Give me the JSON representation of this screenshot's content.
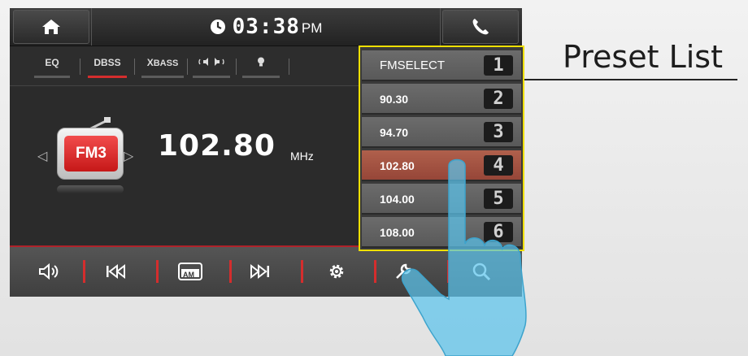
{
  "header": {
    "time": "03:38",
    "ampm": "PM"
  },
  "tabs": [
    {
      "label": "EQ",
      "active": false
    },
    {
      "label": "DBSS",
      "active": true
    },
    {
      "label": "BASS",
      "prefix": "X",
      "active": false
    },
    {
      "label": "balance",
      "icon": "speaker-balance-icon",
      "active": false
    },
    {
      "label": "light",
      "icon": "bulb-icon",
      "active": false
    }
  ],
  "tuner": {
    "band": "FM3",
    "frequency": "102.80",
    "unit": "MHz"
  },
  "presets": [
    {
      "label": "FMSELECT",
      "number": "1",
      "selected": false
    },
    {
      "label": "90.30",
      "number": "2",
      "selected": false
    },
    {
      "label": "94.70",
      "number": "3",
      "selected": false
    },
    {
      "label": "102.80",
      "number": "4",
      "selected": true
    },
    {
      "label": "104.00",
      "number": "5",
      "selected": false
    },
    {
      "label": "108.00",
      "number": "6",
      "selected": false
    }
  ],
  "controls": {
    "am_label": "AM",
    "buttons": [
      "volume-icon",
      "previous-track-icon",
      "am-band-icon",
      "next-track-icon",
      "settings-gear-icon",
      "wrench-icon",
      "search-icon"
    ]
  },
  "annotation": {
    "title": "Preset List"
  },
  "colors": {
    "accent_red": "#d42d2d",
    "highlight_yellow": "#f0e000",
    "selected_preset": "#a35240"
  }
}
